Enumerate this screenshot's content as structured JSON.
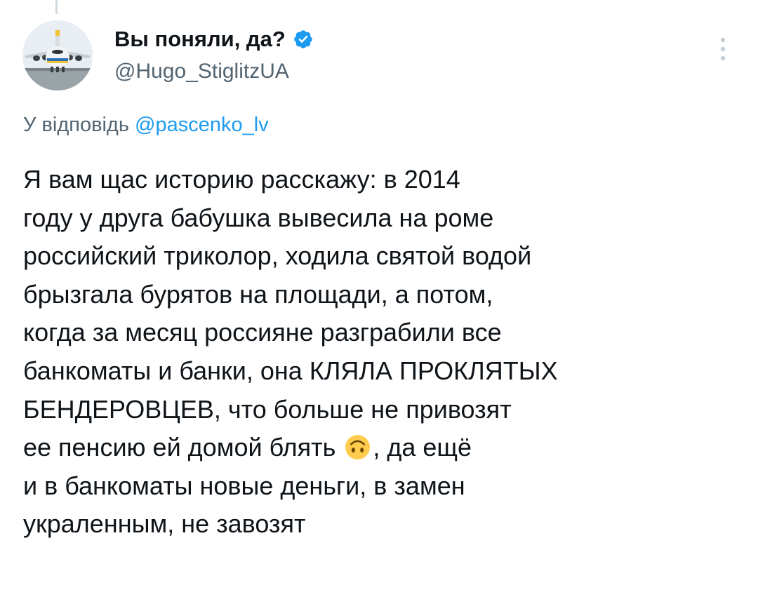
{
  "tweet": {
    "author": {
      "display_name": "Вы поняли, да?",
      "handle": "@Hugo_StiglitzUA",
      "verified": true,
      "avatar_icon": "airplane-avatar"
    },
    "reply_to": {
      "prefix": "У відповідь",
      "mention": "@pascenko_lv"
    },
    "more_icon": "more-vertical-icon",
    "body_lines": [
      "Я вам щас историю расскажу: в 2014",
      "году у друга бабушка вывесила на роме",
      "российский триколор, ходила святой водой",
      "брызгала бурятов на площади, а потом,",
      "когда за месяц россияне разграбили все",
      "банкоматы и банки, она КЛЯЛА ПРОКЛЯТЫХ",
      "БЕНДЕРОВЦЕВ, что больше не привозят",
      "ее пенсию ей домой блять",
      "и в банкоматы новые деньги, в замен",
      "украленным, не завозят"
    ],
    "emoji": {
      "name": "upside-down-face-emoji",
      "after_text": ", да ещё"
    }
  },
  "colors": {
    "text_primary": "#0f1419",
    "text_secondary": "#536471",
    "accent": "#1d9bf0",
    "thread_line": "#cfd9de"
  }
}
